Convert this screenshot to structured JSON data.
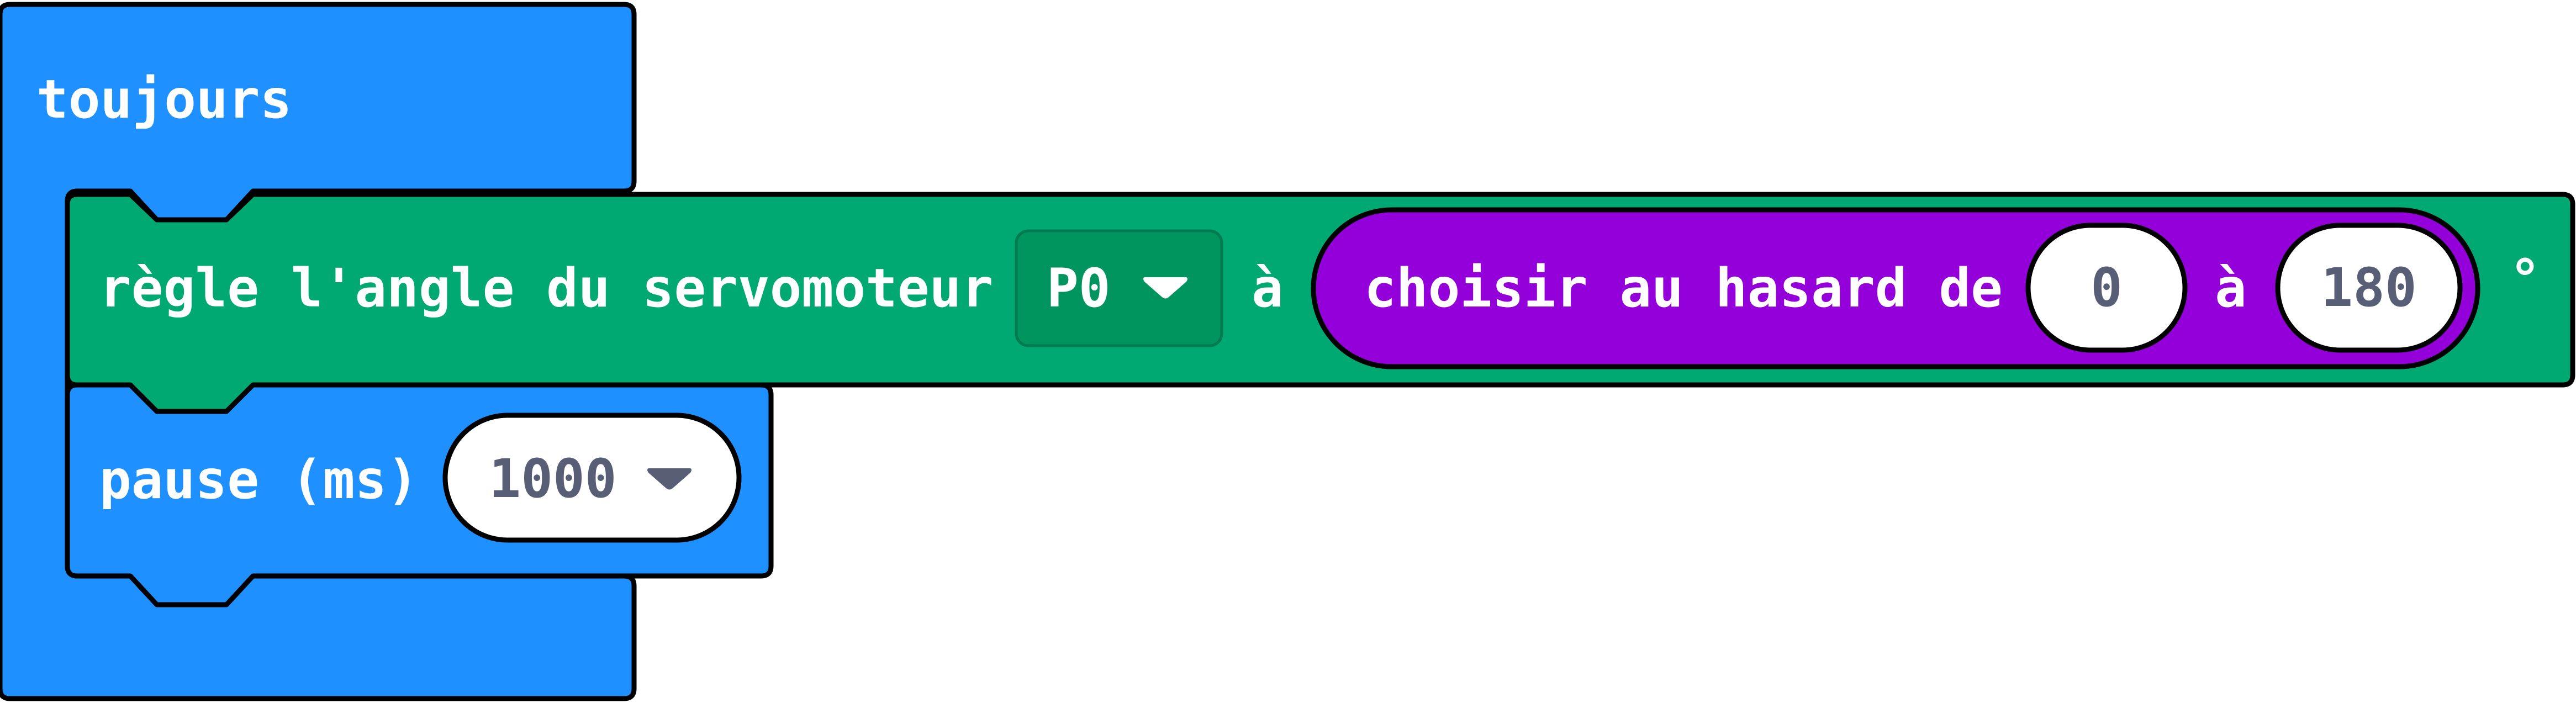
{
  "colors": {
    "loop": "#1e90ff",
    "servo": "#00a971",
    "servo_dropdown": "#00945f",
    "random": "#9400d9",
    "outline": "#000000",
    "field_bg": "#ffffff",
    "field_text": "#575e75"
  },
  "forever_block": {
    "label": "toujours"
  },
  "servo_block": {
    "label": "règle l'angle du servomoteur",
    "pin": {
      "value": "P0",
      "icon": "dropdown-triangle-icon"
    },
    "to_label": "à",
    "unit_label": "°",
    "random_block": {
      "label": "choisir au hasard de",
      "from_value": "0",
      "to_label": "à",
      "to_value": "180"
    }
  },
  "pause_block": {
    "label": "pause (ms)",
    "duration": {
      "value": "1000",
      "icon": "dropdown-triangle-icon"
    }
  }
}
